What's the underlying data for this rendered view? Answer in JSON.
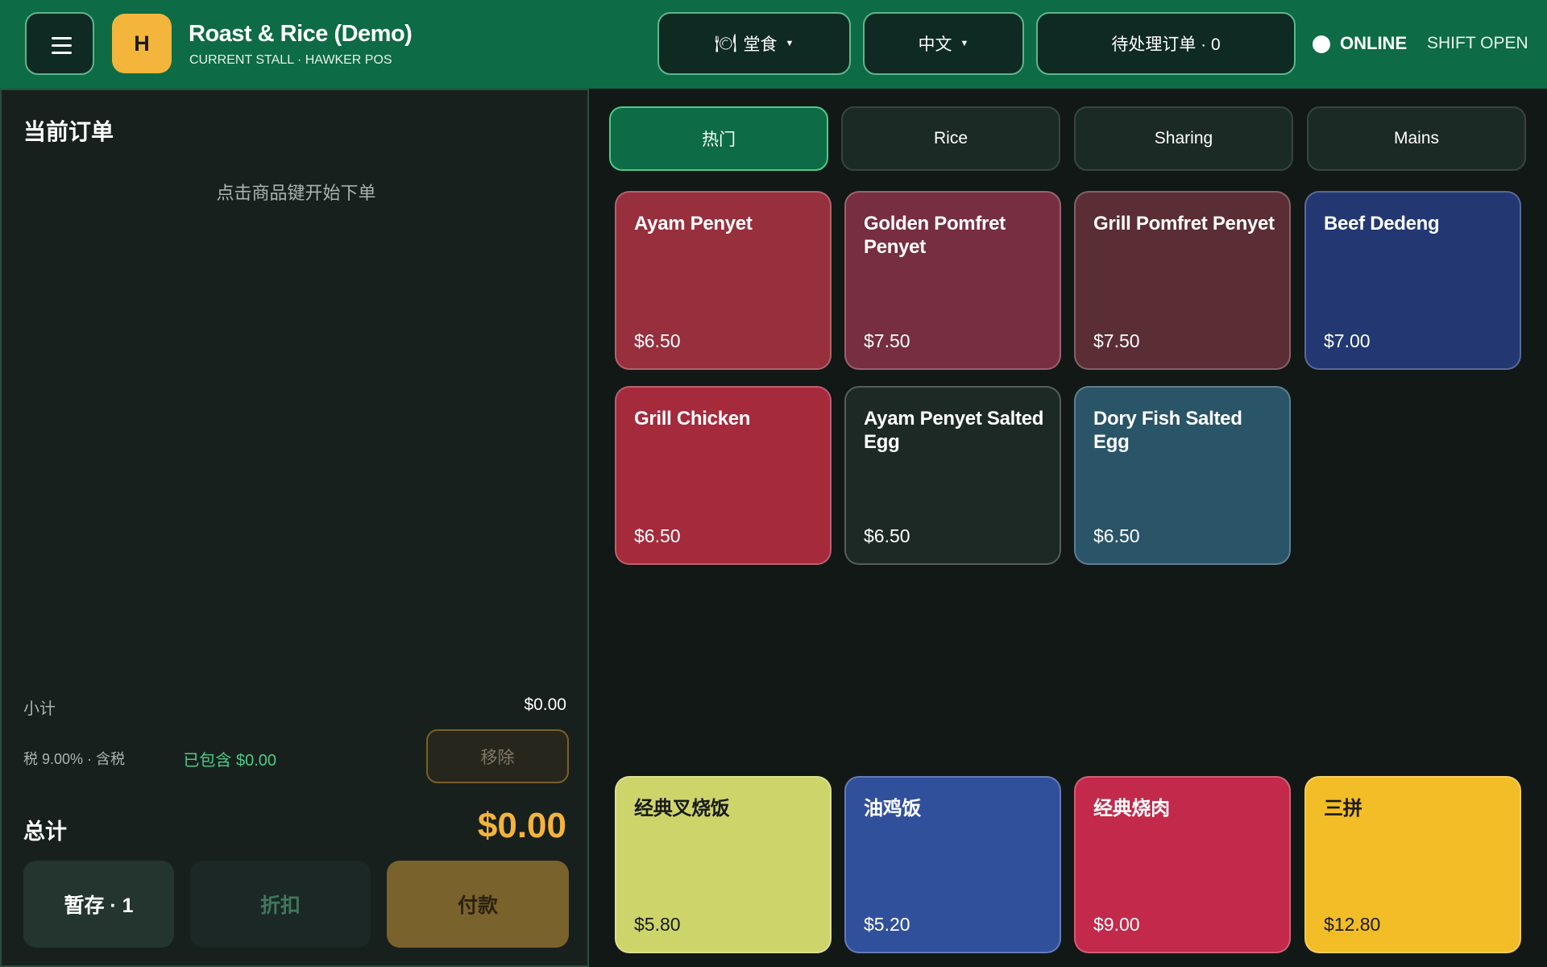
{
  "header": {
    "logo_letter": "H",
    "title": "Roast & Rice (Demo)",
    "subtitle": "CURRENT STALL · HAWKER POS",
    "dine_mode": "堂食",
    "dine_icon": "🍽",
    "language": "中文",
    "pending_orders": "待处理订单 · 0",
    "status": "ONLINE",
    "shift": "SHIFT OPEN"
  },
  "order": {
    "title": "当前订单",
    "empty_hint": "点击商品键开始下单",
    "subtotal_label": "小计",
    "subtotal_value": "$0.00",
    "tax_label": "税 9.00% · 含税",
    "tax_included": "已包含 $0.00",
    "remove_label": "移除",
    "total_label": "总计",
    "total_value": "$0.00",
    "park_label": "暂存 · 1",
    "discount_label": "折扣",
    "pay_label": "付款"
  },
  "categories": [
    {
      "label": "热门",
      "active": true
    },
    {
      "label": "Rice",
      "active": false
    },
    {
      "label": "Sharing",
      "active": false
    },
    {
      "label": "Mains",
      "active": false
    }
  ],
  "products": [
    {
      "name": "Ayam Penyet",
      "price": "$6.50",
      "color": "#972f3d"
    },
    {
      "name": "Golden Pomfret Penyet",
      "price": "$7.50",
      "color": "#762e40"
    },
    {
      "name": "Grill Pomfret Penyet",
      "price": "$7.50",
      "color": "#5b2d35"
    },
    {
      "name": "Beef Dedeng",
      "price": "$7.00",
      "color": "#233873"
    },
    {
      "name": "Grill Chicken",
      "price": "$6.50",
      "color": "#a52a3c"
    },
    {
      "name": "Ayam Penyet Salted Egg",
      "price": "$6.50",
      "color": "#1c2925"
    },
    {
      "name": "Dory Fish Salted Egg",
      "price": "$6.50",
      "color": "#2a5468"
    }
  ],
  "featured": [
    {
      "name": "经典叉烧饭",
      "price": "$5.80",
      "color": "#cdd56a",
      "dark": true
    },
    {
      "name": "油鸡饭",
      "price": "$5.20",
      "color": "#31509c",
      "dark": false
    },
    {
      "name": "经典烧肉",
      "price": "$9.00",
      "color": "#c2294a",
      "dark": false
    },
    {
      "name": "三拼",
      "price": "$12.80",
      "color": "#f2bd26",
      "dark": true
    }
  ]
}
